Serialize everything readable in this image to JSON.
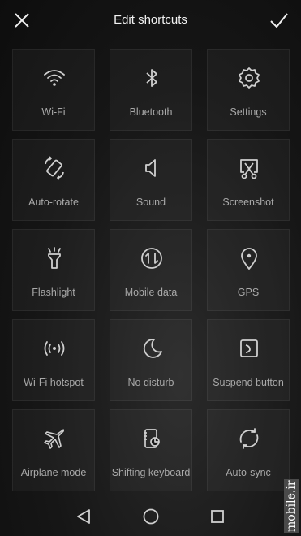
{
  "header": {
    "title": "Edit shortcuts",
    "close_icon": "close-icon",
    "confirm_icon": "checkmark-icon"
  },
  "tiles": [
    {
      "label": "Wi-Fi",
      "icon": "wifi-icon"
    },
    {
      "label": "Bluetooth",
      "icon": "bluetooth-icon"
    },
    {
      "label": "Settings",
      "icon": "gear-icon"
    },
    {
      "label": "Auto-rotate",
      "icon": "auto-rotate-icon"
    },
    {
      "label": "Sound",
      "icon": "speaker-icon"
    },
    {
      "label": "Screenshot",
      "icon": "screenshot-icon"
    },
    {
      "label": "Flashlight",
      "icon": "flashlight-icon"
    },
    {
      "label": "Mobile data",
      "icon": "mobile-data-icon"
    },
    {
      "label": "GPS",
      "icon": "location-pin-icon"
    },
    {
      "label": "Wi-Fi hotspot",
      "icon": "hotspot-icon"
    },
    {
      "label": "No disturb",
      "icon": "moon-icon"
    },
    {
      "label": "Suspend button",
      "icon": "suspend-button-icon"
    },
    {
      "label": "Airplane mode",
      "icon": "airplane-icon"
    },
    {
      "label": "Shifting keyboard",
      "icon": "shifting-keyboard-icon"
    },
    {
      "label": "Auto-sync",
      "icon": "sync-icon"
    }
  ],
  "navbar": {
    "back_icon": "back-triangle-icon",
    "home_icon": "home-circle-icon",
    "recents_icon": "recents-square-icon"
  },
  "watermark": {
    "text": "mobile.ir"
  },
  "colors": {
    "background": "#161616",
    "icon": "#cfcfcf",
    "label": "#a9a9a9"
  }
}
